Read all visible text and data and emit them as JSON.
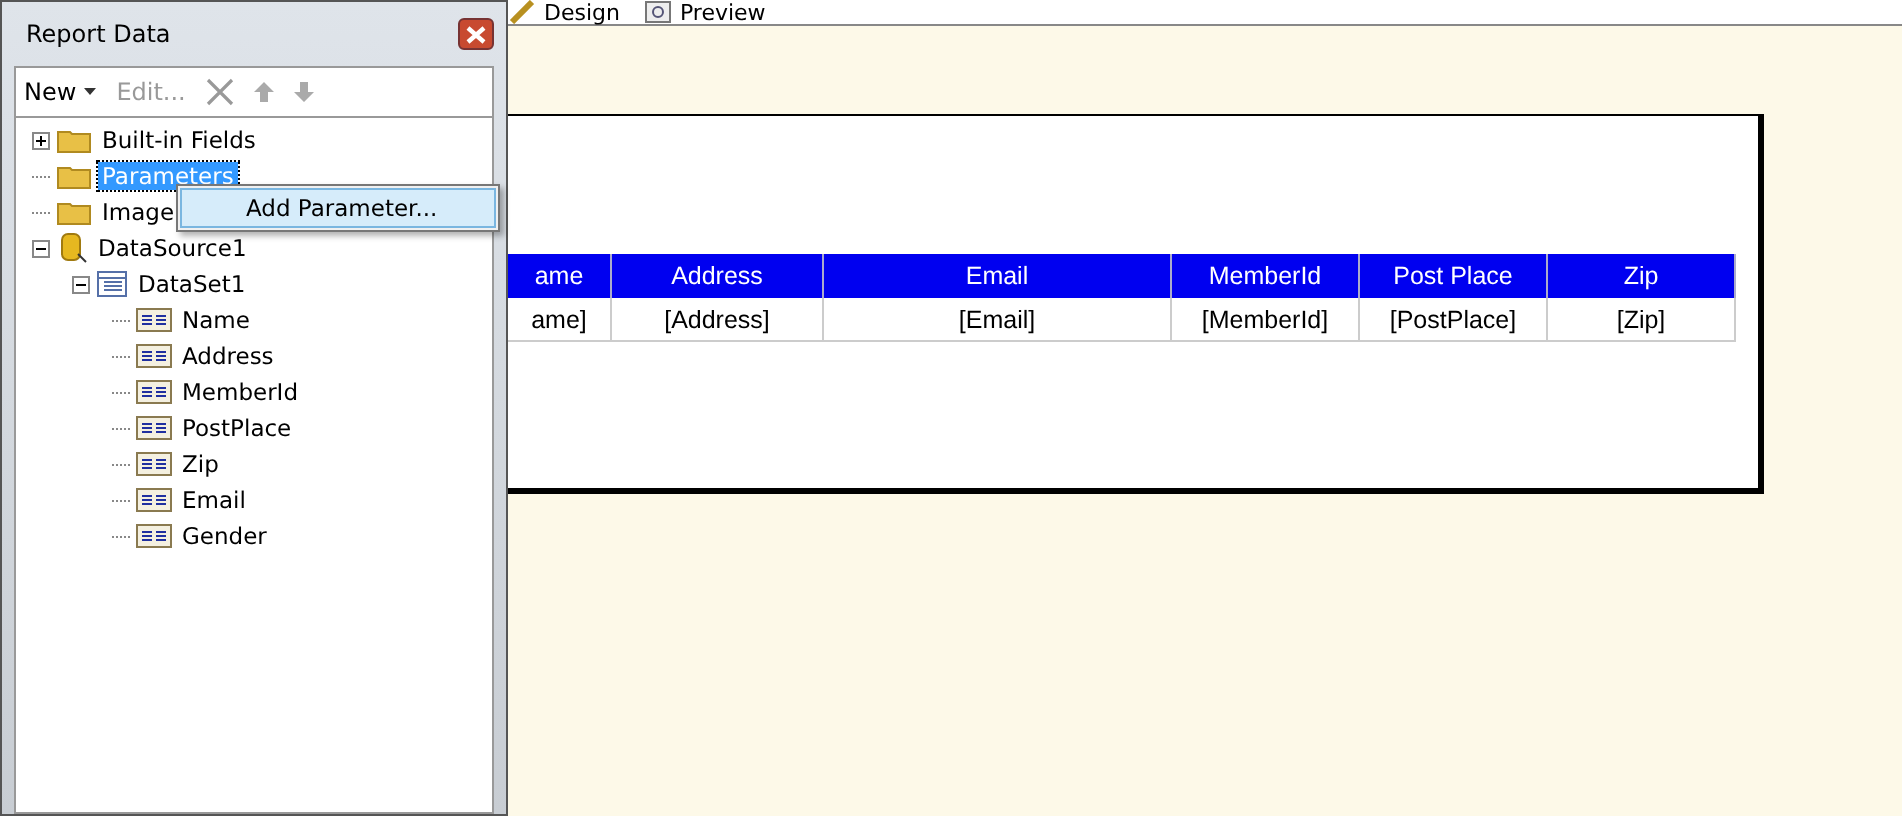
{
  "panel": {
    "title": "Report Data",
    "toolbar": [
      {
        "kind": "dropdown",
        "label": "New",
        "disabled": false
      },
      {
        "kind": "text",
        "label": "Edit...",
        "disabled": true
      },
      {
        "kind": "delete",
        "disabled": true
      },
      {
        "kind": "up",
        "disabled": true
      },
      {
        "kind": "down",
        "disabled": true
      }
    ],
    "tree": [
      {
        "kind": "folder",
        "label": "Built-in Fields",
        "expanded": false,
        "selected": false
      },
      {
        "kind": "folder",
        "label": "Parameters",
        "selected": true
      },
      {
        "kind": "folder",
        "label": "Image",
        "selected": false
      },
      {
        "kind": "datasource",
        "label": "DataSource1",
        "expanded": true,
        "selected": false,
        "children": [
          {
            "kind": "dataset",
            "label": "DataSet1",
            "expanded": true,
            "selected": false,
            "children": [
              {
                "kind": "field",
                "label": "Name",
                "selected": false
              },
              {
                "kind": "field",
                "label": "Address",
                "selected": false
              },
              {
                "kind": "field",
                "label": "MemberId",
                "selected": false
              },
              {
                "kind": "field",
                "label": "PostPlace",
                "selected": false
              },
              {
                "kind": "field",
                "label": "Zip",
                "selected": false
              },
              {
                "kind": "field",
                "label": "Email",
                "selected": false
              },
              {
                "kind": "field",
                "label": "Gender",
                "selected": false
              }
            ]
          }
        ]
      }
    ],
    "context_menu": [
      "Add Parameter..."
    ]
  },
  "tabs": [
    {
      "label": "Design"
    },
    {
      "label": "Preview"
    }
  ],
  "table": {
    "columns": [
      "ame",
      "Address",
      "Email",
      "MemberId",
      "Post Place",
      "Zip"
    ],
    "rows": [
      [
        "ame]",
        "[Address]",
        "[Email]",
        "[MemberId]",
        "[PostPlace]",
        "[Zip]"
      ]
    ]
  }
}
